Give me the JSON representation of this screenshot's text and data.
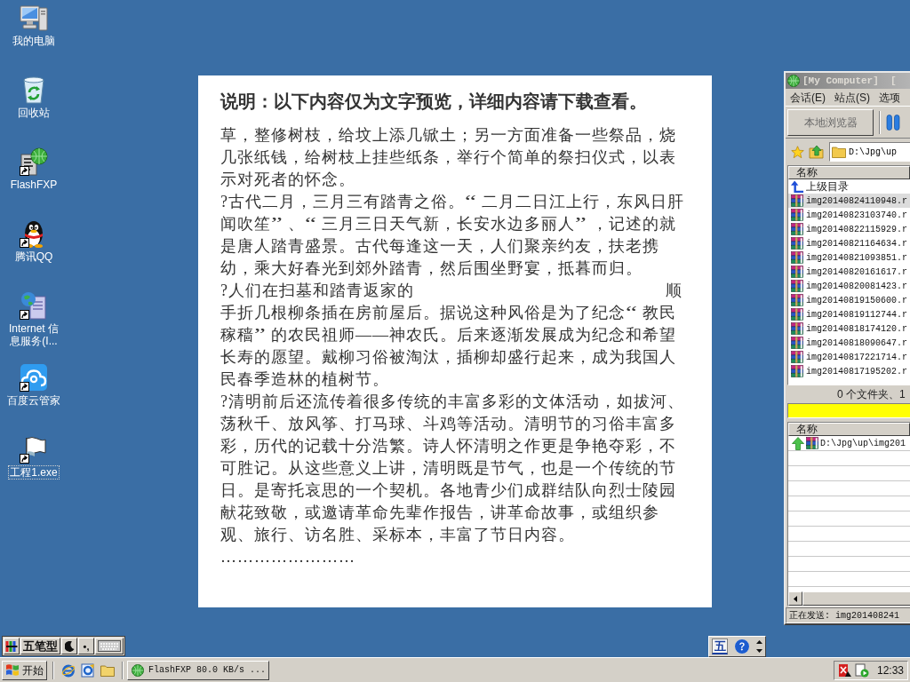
{
  "desktop_icons": [
    {
      "label": "我的电脑",
      "kind": "computer",
      "shortcut": false,
      "focused": false
    },
    {
      "label": "回收站",
      "kind": "recycle_bin",
      "shortcut": false,
      "focused": false
    },
    {
      "label": "FlashFXP",
      "kind": "flashfxp",
      "shortcut": true,
      "focused": false
    },
    {
      "label": "腾讯QQ",
      "kind": "qq",
      "shortcut": true,
      "focused": false
    },
    {
      "label": "Internet 信息服务(I...",
      "kind": "iis",
      "shortcut": true,
      "focused": false
    },
    {
      "label": "百度云管家",
      "kind": "baidu_cloud",
      "shortcut": true,
      "focused": false
    },
    {
      "label": "工程1.exe",
      "kind": "exe",
      "shortcut": true,
      "focused": true
    }
  ],
  "document": {
    "title": "说明：以下内容仅为文字预览，详细内容请下载查看。",
    "paragraphs": [
      {
        "text": "草，整修树枝，给坟上添几锨土；另一方面准备一些祭品，烧几张纸钱，给树枝上挂些纸条，举行个简单的祭扫仪式，以表示对死者的怀念。"
      },
      {
        "text": "?古代二月，三月三有踏青之俗。“二月二日江上行，东风日肝闻吹笙”、“三月三日天气新，长安水边多丽人”，记述的就是唐人踏青盛景。古代每逢这一天，人们聚亲约友，扶老携幼，乘大好春光到郊外踏青，然后围坐野宴，抵暮而归。"
      },
      {
        "segments": [
          "?人们在扫墓和踏青返家的",
          "顺手折几根柳条插在房前屋后。据说这种风俗是为了纪念“教民稼穑”的农民祖师——神农氏。后来逐渐发展成为纪念和希望长寿的愿望。戴柳习俗被淘汰，插柳却盛行起来，成为我国人民春季造林的植树节。"
        ]
      },
      {
        "text": "?清明前后还流传着很多传统的丰富多彩的文体活动，如拔河、荡秋千、放风筝、打马球、斗鸡等活动。清明节的习俗丰富多彩，历代的记载十分浩繁。诗人怀清明之作更是争艳夺彩，不可胜记。从这些意义上讲，清明既是节气，也是一个传统的节日。是寄托哀思的一个契机。各地青少们成群结队向烈士陵园献花致敬，或邀请革命先辈作报告，讲革命故事，或组织参观、旅行、访名胜、采标本，丰富了节日内容。"
      }
    ],
    "ellipsis": "……………………"
  },
  "ftp_window": {
    "title": "[My Computer]  [",
    "menu": [
      "会话(E)",
      "站点(S)",
      "选项"
    ],
    "toolbar_button": "本地浏览器",
    "path": "D:\\Jpg\\up",
    "file_list": {
      "column": "名称",
      "rows": [
        {
          "name": "上级目录",
          "kind": "parent",
          "selected": false
        },
        {
          "name": "img20140824110948.r",
          "kind": "archive",
          "selected": true
        },
        {
          "name": "img20140823103740.r",
          "kind": "archive",
          "selected": false
        },
        {
          "name": "img20140822115929.r",
          "kind": "archive",
          "selected": false
        },
        {
          "name": "img20140821164634.r",
          "kind": "archive",
          "selected": false
        },
        {
          "name": "img20140821093851.r",
          "kind": "archive",
          "selected": false
        },
        {
          "name": "img20140820161617.r",
          "kind": "archive",
          "selected": false
        },
        {
          "name": "img20140820081423.r",
          "kind": "archive",
          "selected": false
        },
        {
          "name": "img20140819150600.r",
          "kind": "archive",
          "selected": false
        },
        {
          "name": "img20140819112744.r",
          "kind": "archive",
          "selected": false
        },
        {
          "name": "img20140818174120.r",
          "kind": "archive",
          "selected": false
        },
        {
          "name": "img20140818090647.r",
          "kind": "archive",
          "selected": false
        },
        {
          "name": "img20140817221714.r",
          "kind": "archive",
          "selected": false
        },
        {
          "name": "img20140817195202.r",
          "kind": "archive",
          "selected": false
        }
      ]
    },
    "summary": "0 个文件夹、1",
    "queue": {
      "column": "名称",
      "rows": [
        {
          "name": "D:\\Jpg\\up\\img201",
          "kind": "upload"
        }
      ]
    },
    "status": "正在发送: img201408241"
  },
  "ime_bar": {
    "mode": "五笔型",
    "punctuation": "•,"
  },
  "language_bar": {
    "indicator": "五"
  },
  "taskbar": {
    "start": "开始",
    "quick_launch": [
      {
        "kind": "browser"
      },
      {
        "kind": "page"
      },
      {
        "kind": "folder"
      }
    ],
    "tasks": [
      {
        "label": "FlashFXP 80.0 KB/s ...",
        "selected": false
      }
    ],
    "clock": "12:33"
  }
}
